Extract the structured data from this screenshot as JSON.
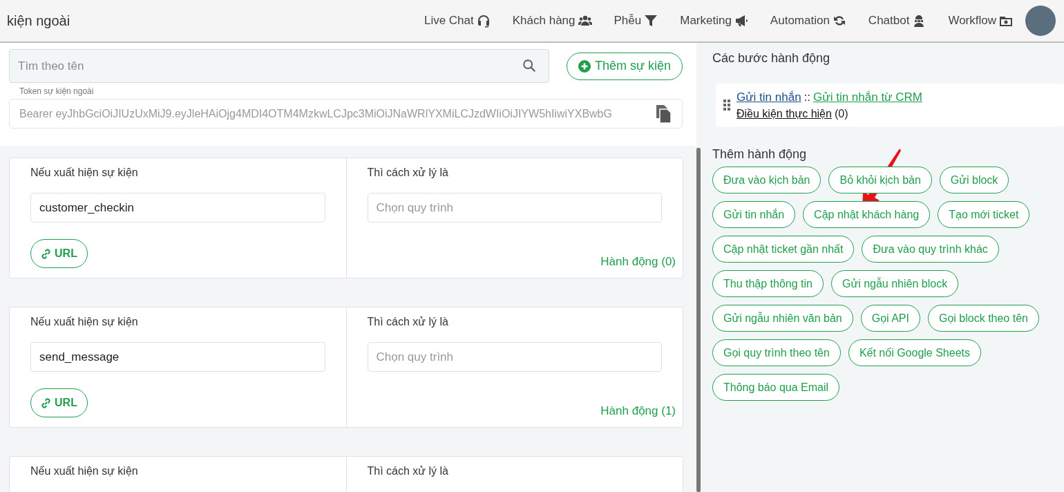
{
  "header": {
    "title": "kiện ngoài",
    "nav": [
      "Live Chat",
      "Khách hàng",
      "Phễu",
      "Marketing",
      "Automation",
      "Chatbot",
      "Workflow"
    ]
  },
  "search": {
    "placeholder": "Tìm theo tên"
  },
  "add_button": {
    "label": "Thêm sự kiện"
  },
  "token": {
    "label": "Token sự kiện ngoài",
    "value": "Bearer eyJhbGciOiJIUzUxMiJ9.eyJleHAiOjg4MDI4OTM4MzkwLCJpc3MiOiJNaWRlYXMiLCJzdWIiOiJIYW5hIiwiYXBwbG"
  },
  "events": [
    {
      "if_label": "Nếu xuất hiện sự kiện",
      "event_name": "customer_checkin",
      "url_button": "URL",
      "then_label": "Thì cách xử lý là",
      "workflow_placeholder": "Chọn quy trình",
      "actions": "Hành động (0)"
    },
    {
      "if_label": "Nếu xuất hiện sự kiện",
      "event_name": "send_message",
      "url_button": "URL",
      "then_label": "Thì cách xử lý là",
      "workflow_placeholder": "Chọn quy trình",
      "actions": "Hành động (1)"
    },
    {
      "if_label": "Nếu xuất hiện sự kiện",
      "then_label": "Thì cách xử lý là"
    }
  ],
  "steps_panel": {
    "title": "Các bước hành động",
    "steps": [
      {
        "action": "Gửi tin nhắn",
        "separator": "::",
        "detail": "Gửi tin nhắn từ CRM",
        "condition": "Điều kiện thực hiện",
        "condition_count": "(0)"
      }
    ]
  },
  "add_actions": {
    "title": "Thêm hành động",
    "items": [
      "Đưa vào kịch bản",
      "Bỏ khỏi kịch bản",
      "Gửi block",
      "Gửi tin nhắn",
      "Cập nhật khách hàng",
      "Tạo mới ticket",
      "Cập nhật ticket gần nhất",
      "Đưa vào quy trình khác",
      "Thu thập thông tin",
      "Gửi ngẫu nhiên block",
      "Gửi ngẫu nhiên văn bản",
      "Gọi API",
      "Gọi block theo tên",
      "Gọi quy trình theo tên",
      "Kết nối Google Sheets",
      "Thông báo qua Email"
    ]
  }
}
